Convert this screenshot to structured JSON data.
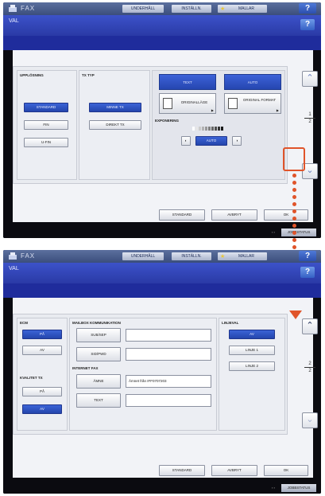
{
  "colors": {
    "accent": "#2a45b0",
    "highlight": "#e0542a"
  },
  "app": {
    "title": "FAX",
    "top_buttons": [
      "UNDERHÅLL",
      "INSTÄLLN.",
      "MALLAR"
    ],
    "help": "?"
  },
  "header": {
    "label": "VAL",
    "help": "?"
  },
  "page1": {
    "upplosning": {
      "title": "UPPLÖSNING",
      "options": [
        "STANDARD",
        "FIN",
        "U-FIN"
      ],
      "selected": 0
    },
    "tx_typ": {
      "title": "TX TYP",
      "options": [
        "MINNE TX",
        "DIREKT TX"
      ],
      "selected": 0
    },
    "mode_tabs": [
      "TEXT",
      "AUTO"
    ],
    "originallage": {
      "label": "ORIGINALLÄGE"
    },
    "originalformat": {
      "label": "ORIGINAL FORMAT"
    },
    "exponering": {
      "title": "EXPONERING",
      "auto": "AUTO"
    },
    "page": {
      "current": "1",
      "total": "2"
    }
  },
  "page2": {
    "ecm": {
      "title": "ECM",
      "options": [
        "PÅ",
        "AV"
      ],
      "selected": 0
    },
    "kvalitet": {
      "title": "KVALITET TX",
      "options": [
        "PÅ",
        "AV"
      ],
      "selected": 1
    },
    "mailbox": {
      "title": "MAILBOX KOMMUNIKATION",
      "buttons": [
        "SUB/SEP",
        "SID/PWD"
      ]
    },
    "internet_fax": {
      "title": "INTERNET FAX",
      "amne_label": "ÄMNE",
      "amne_value": "Ämnet från IFF0707203",
      "text_label": "TEXT"
    },
    "linjeval": {
      "title": "LINJEVAL",
      "options": [
        "AV",
        "LINJE 1",
        "LINJE 2"
      ],
      "selected": 0
    },
    "page": {
      "current": "2",
      "total": "2"
    }
  },
  "actions": {
    "standard": "STANDARD",
    "avbryt": "AVBRYT",
    "ok": "OK"
  },
  "footer": {
    "job_status": "JOBBSTATUS"
  }
}
